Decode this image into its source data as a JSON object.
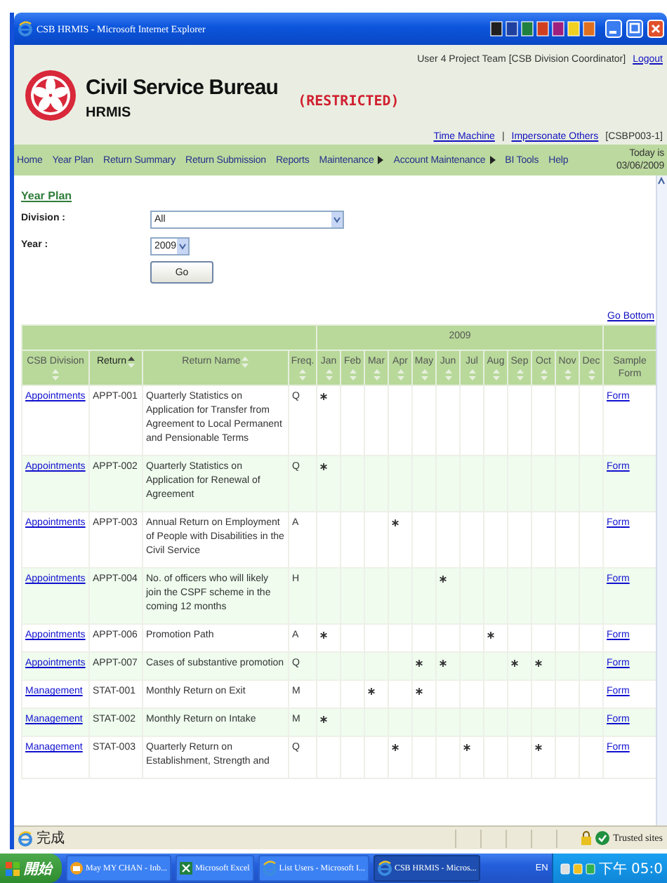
{
  "window": {
    "title": "CSB HRMIS - Microsoft Internet Explorer"
  },
  "header": {
    "user": "User 4 Project Team [CSB Division Coordinator]",
    "logout": "Logout",
    "title": "Civil Service Bureau",
    "subtitle": "HRMIS",
    "classification": "(RESTRICTED)",
    "links": [
      "Time Machine",
      "Impersonate Others"
    ],
    "separator": "|",
    "page_code": "[CSBP003-1]"
  },
  "nav": {
    "items": [
      {
        "label": "Home",
        "submenu": false
      },
      {
        "label": "Year Plan",
        "submenu": false
      },
      {
        "label": "Return Summary",
        "submenu": false
      },
      {
        "label": "Return Submission",
        "submenu": false
      },
      {
        "label": "Reports",
        "submenu": false
      },
      {
        "label": "Maintenance",
        "submenu": true
      },
      {
        "label": "Account Maintenance",
        "submenu": true
      },
      {
        "label": "BI Tools",
        "submenu": false
      },
      {
        "label": "Help",
        "submenu": false
      }
    ],
    "today_label": "Today is",
    "today": "03/06/2009"
  },
  "breadcrumb": "Year Plan",
  "filters": [
    {
      "label": "Division :",
      "value": "All",
      "kind": "wide"
    },
    {
      "label": "Year :",
      "value": "2009",
      "kind": "narrow"
    }
  ],
  "go_button": "Go",
  "go_bottom": "Go Bottom",
  "table": {
    "group_header": "2009",
    "columns": [
      {
        "label": "CSB Division",
        "sortable": true,
        "sorted": false
      },
      {
        "label": "Return",
        "sortable": true,
        "sorted": true
      },
      {
        "label": "Return Name",
        "sortable": true,
        "sorted": false
      },
      {
        "label": "Freq.",
        "sortable": true,
        "sorted": false
      },
      {
        "label": "Jan",
        "sortable": true,
        "sorted": false
      },
      {
        "label": "Feb",
        "sortable": true,
        "sorted": false
      },
      {
        "label": "Mar",
        "sortable": true,
        "sorted": false
      },
      {
        "label": "Apr",
        "sortable": true,
        "sorted": false
      },
      {
        "label": "May",
        "sortable": true,
        "sorted": false
      },
      {
        "label": "Jun",
        "sortable": true,
        "sorted": false
      },
      {
        "label": "Jul",
        "sortable": true,
        "sorted": false
      },
      {
        "label": "Aug",
        "sortable": true,
        "sorted": false
      },
      {
        "label": "Sep",
        "sortable": true,
        "sorted": false
      },
      {
        "label": "Oct",
        "sortable": true,
        "sorted": false
      },
      {
        "label": "Nov",
        "sortable": true,
        "sorted": false
      },
      {
        "label": "Dec",
        "sortable": true,
        "sorted": false
      },
      {
        "label": "Sample Form",
        "sortable": false
      }
    ],
    "rows": [
      {
        "division": "Appointments",
        "return": "APPT-001",
        "name": "Quarterly Statistics on Application for Transfer from Agreement to Local Permanent and Pensionable Terms",
        "freq": "Q",
        "planned": [
          true,
          false,
          false,
          false,
          false,
          false,
          false,
          false,
          false,
          false,
          false,
          false
        ],
        "form": "Form"
      },
      {
        "division": "Appointments",
        "return": "APPT-002",
        "name": "Quarterly Statistics on Application for Renewal of Agreement",
        "freq": "Q",
        "planned": [
          true,
          false,
          false,
          false,
          false,
          false,
          false,
          false,
          false,
          false,
          false,
          false
        ],
        "form": "Form"
      },
      {
        "division": "Appointments",
        "return": "APPT-003",
        "name": "Annual Return on Employment of People with Disabilities in the Civil Service",
        "freq": "A",
        "planned": [
          false,
          false,
          false,
          true,
          false,
          false,
          false,
          false,
          false,
          false,
          false,
          false
        ],
        "form": "Form"
      },
      {
        "division": "Appointments",
        "return": "APPT-004",
        "name": "No. of officers who will likely join the CSPF scheme in the coming 12 months",
        "freq": "H",
        "planned": [
          false,
          false,
          false,
          false,
          false,
          true,
          false,
          false,
          false,
          false,
          false,
          false
        ],
        "form": "Form"
      },
      {
        "division": "Appointments",
        "return": "APPT-006",
        "name": "Promotion Path",
        "freq": "A",
        "planned": [
          true,
          false,
          false,
          false,
          false,
          false,
          false,
          true,
          false,
          false,
          false,
          false
        ],
        "form": "Form"
      },
      {
        "division": "Appointments",
        "return": "APPT-007",
        "name": "Cases of substantive promotion",
        "freq": "Q",
        "planned": [
          false,
          false,
          false,
          false,
          true,
          true,
          false,
          false,
          true,
          true,
          false,
          false
        ],
        "form": "Form"
      },
      {
        "division": "Management",
        "return": "STAT-001",
        "name": "Monthly Return on Exit",
        "freq": "M",
        "planned": [
          false,
          false,
          true,
          false,
          true,
          false,
          false,
          false,
          false,
          false,
          false,
          false
        ],
        "form": "Form"
      },
      {
        "division": "Management",
        "return": "STAT-002",
        "name": "Monthly Return on Intake",
        "freq": "M",
        "planned": [
          true,
          false,
          false,
          false,
          false,
          false,
          false,
          false,
          false,
          false,
          false,
          false
        ],
        "form": "Form"
      },
      {
        "division": "Management",
        "return": "STAT-003",
        "name": "Quarterly Return on Establishment, Strength and",
        "freq": "Q",
        "planned": [
          false,
          false,
          false,
          true,
          false,
          false,
          true,
          false,
          false,
          true,
          false,
          false
        ],
        "form": "Form"
      }
    ]
  },
  "status_bar": {
    "text": "完成",
    "zone": "Trusted sites"
  },
  "taskbar": {
    "start": "開始",
    "tasks": [
      {
        "label": "May MY CHAN - Inb...",
        "kind": "mail",
        "selected": false
      },
      {
        "label": "Microsoft Excel",
        "kind": "excel",
        "selected": false
      },
      {
        "label": "List Users - Microsoft I...",
        "kind": "browser",
        "selected": false
      },
      {
        "label": "CSB HRMIS - Micros...",
        "kind": "browser",
        "selected": true
      }
    ],
    "language": "EN",
    "clock": "下午 05:0"
  }
}
